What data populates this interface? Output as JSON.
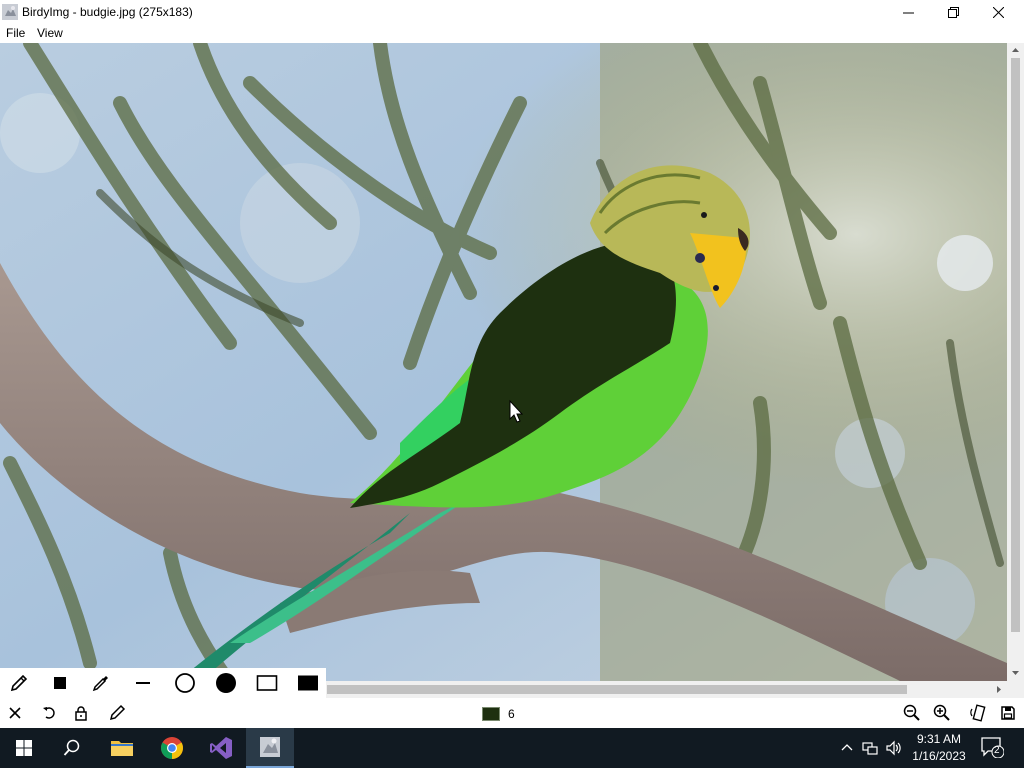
{
  "window": {
    "title": "BirdyImg - budgie.jpg (275x183)"
  },
  "menu": {
    "file": "File",
    "view": "View"
  },
  "draw_tools": [
    "pen-icon",
    "filled-square-icon",
    "eyedropper-icon",
    "line-icon",
    "circle-outline-icon",
    "filled-circle-icon",
    "rectangle-outline-icon",
    "filled-rectangle-icon"
  ],
  "status": {
    "selected_color": "#1e3010",
    "brush_size": "6"
  },
  "taskbar": {
    "time": "9:31 AM",
    "date": "1/16/2023",
    "notification_count": "2"
  },
  "colors": {
    "taskbar_bg": "#111a22",
    "accent": "#7aa6d8",
    "painted_stroke": "#1e3010"
  }
}
